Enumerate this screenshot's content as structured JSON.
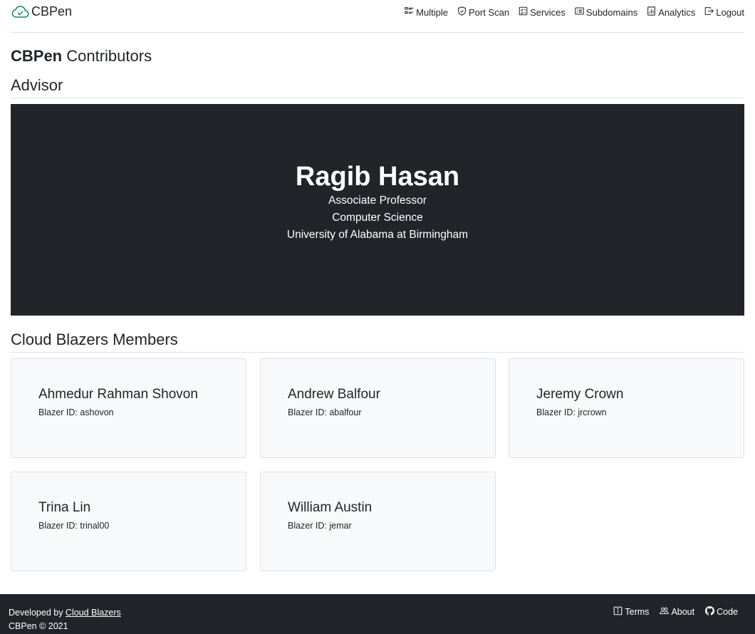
{
  "navbar": {
    "brand": "CBPen",
    "links": [
      {
        "label": "Multiple",
        "icon": "list-check-icon"
      },
      {
        "label": "Port Scan",
        "icon": "shield-check-icon"
      },
      {
        "label": "Services",
        "icon": "checklist-icon"
      },
      {
        "label": "Subdomains",
        "icon": "card-list-icon"
      },
      {
        "label": "Analytics",
        "icon": "bar-chart-icon"
      },
      {
        "label": "Logout",
        "icon": "box-arrow-right-icon"
      }
    ]
  },
  "page": {
    "title_bold": "CBPen",
    "title_rest": " Contributors"
  },
  "advisor": {
    "heading": "Advisor",
    "name": "Ragib Hasan",
    "lines": [
      "Associate Professor",
      "Computer Science",
      "University of Alabama at Birmingham"
    ]
  },
  "members": {
    "heading": "Cloud Blazers Members",
    "items": [
      {
        "name": "Ahmedur Rahman Shovon",
        "id": "Blazer ID: ashovon"
      },
      {
        "name": "Andrew Balfour",
        "id": "Blazer ID: abalfour"
      },
      {
        "name": "Jeremy Crown",
        "id": "Blazer ID: jrcrown"
      },
      {
        "name": "Trina Lin",
        "id": "Blazer ID: trinal00"
      },
      {
        "name": "William Austin",
        "id": "Blazer ID: jemar"
      }
    ]
  },
  "footer": {
    "developed_by": "Developed by ",
    "developer_link": "Cloud Blazers",
    "copyright": "CBPen © 2021",
    "links": [
      {
        "label": "Terms",
        "icon": "info-square-icon"
      },
      {
        "label": "About",
        "icon": "people-icon"
      },
      {
        "label": "Code",
        "icon": "github-icon"
      }
    ]
  },
  "colors": {
    "brand_icon": "#198754",
    "dark": "#212529",
    "card_bg": "#f8f9fa",
    "border": "#dee2e6"
  }
}
